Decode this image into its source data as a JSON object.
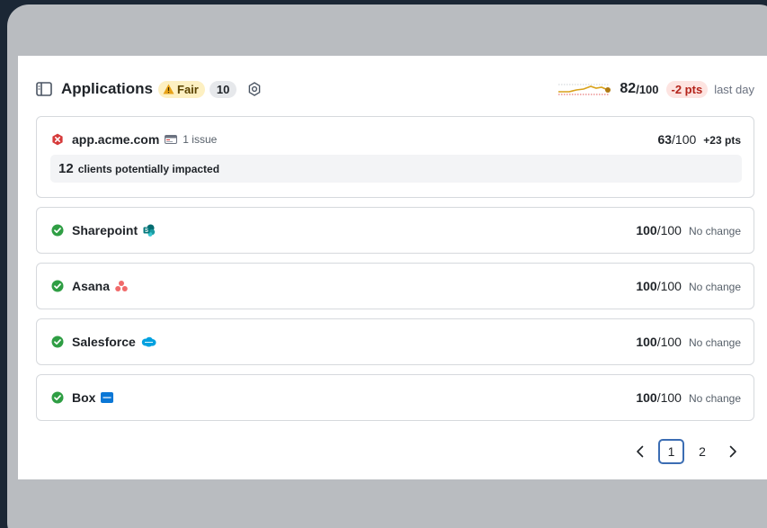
{
  "header": {
    "title": "Applications",
    "status_label": "Fair",
    "count": "10",
    "score": "82",
    "score_denominator": "/100",
    "delta": "-2 pts",
    "period": "last day",
    "status_color": "#fdf0c2",
    "delta_color": "#fde4e1"
  },
  "apps": [
    {
      "name": "app.acme.com",
      "status": "error",
      "issues": "1 issue",
      "score": "63",
      "score_denominator": "/100",
      "change": "+23 pts",
      "impact_count": "12",
      "impact_text": "clients potentially impacted"
    },
    {
      "name": "Sharepoint",
      "status": "ok",
      "logo": "sharepoint-logo",
      "score": "100",
      "score_denominator": "/100",
      "change": "No change"
    },
    {
      "name": "Asana",
      "status": "ok",
      "logo": "asana-logo",
      "score": "100",
      "score_denominator": "/100",
      "change": "No change"
    },
    {
      "name": "Salesforce",
      "status": "ok",
      "logo": "salesforce-logo",
      "score": "100",
      "score_denominator": "/100",
      "change": "No change"
    },
    {
      "name": "Box",
      "status": "ok",
      "logo": "box-logo",
      "score": "100",
      "score_denominator": "/100",
      "change": "No change"
    }
  ],
  "pagination": {
    "pages": [
      "1",
      "2"
    ],
    "current": "1"
  },
  "colors": {
    "ok": "#2f9e44",
    "error": "#d63b3b",
    "active_page_border": "#3b6db3"
  }
}
